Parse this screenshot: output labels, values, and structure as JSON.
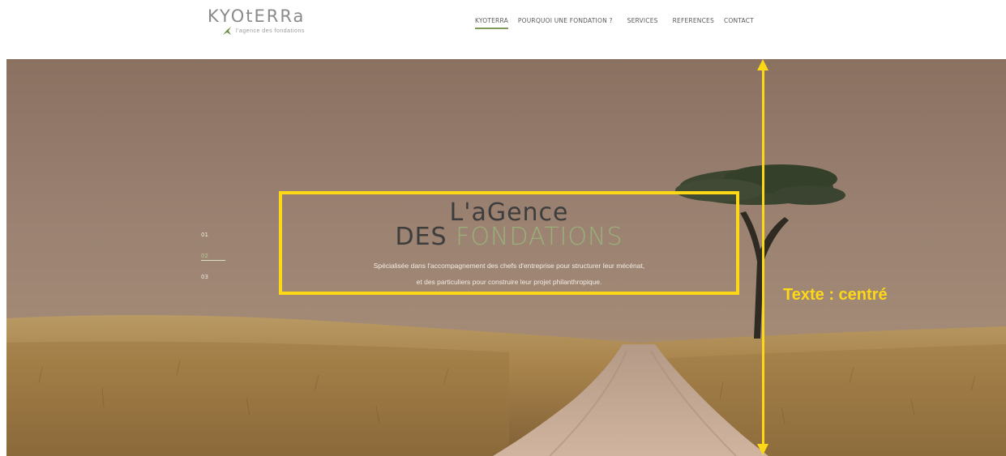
{
  "brand": {
    "logo_text": "KYOtERRa",
    "tagline": "l'agence des fondations"
  },
  "nav": {
    "items": [
      {
        "label": "KYOTERRA",
        "active": true
      },
      {
        "label": "POURQUOI UNE FONDATION ?",
        "active": false
      },
      {
        "label": "SERVICES",
        "active": false
      },
      {
        "label": "REFERENCES",
        "active": false
      },
      {
        "label": "CONTACT",
        "active": false
      }
    ]
  },
  "hero": {
    "slides": [
      "01",
      "02",
      "03"
    ],
    "active_slide": "02",
    "title_line1": "L'aGence",
    "title_line2_a": "DES ",
    "title_line2_b": "FONDATIONS",
    "subtitle_line1": "Spécialisée dans l'accompagnement des chefs d'entreprise pour structurer leur mécénat,",
    "subtitle_line2": "et des particuliers pour construire leur projet philanthropique."
  },
  "annotation": {
    "label": "Texte : centré",
    "color": "#fdd817"
  },
  "colors": {
    "accent_green": "#9ab07a",
    "nav_underline": "#7e9a5a"
  }
}
